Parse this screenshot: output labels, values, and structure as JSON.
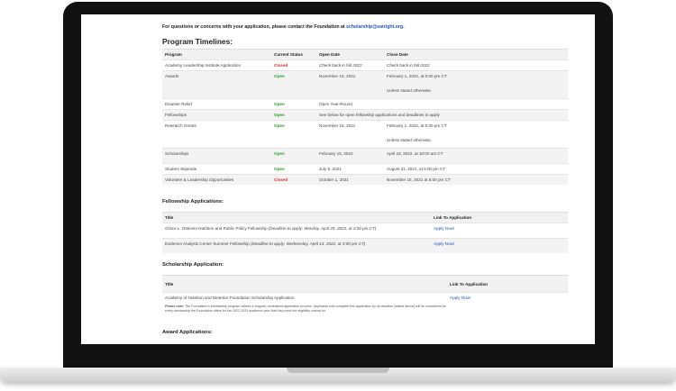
{
  "notice": {
    "text": "For questions or concerns with your application, please contact the Foundation at",
    "email": "scholarship@eatright.org",
    "end": "."
  },
  "timelines": {
    "title": "Program Timelines:",
    "headers": [
      "Program",
      "Current Status",
      "Open Date",
      "Close Date"
    ],
    "rows": [
      {
        "program": "Academy Leadership Institute Application",
        "status": "Closed",
        "open": "Check back in fall 2022",
        "close": "Check back in fall 2022",
        "close2": ""
      },
      {
        "program": "Awards",
        "status": "Open",
        "open": "November 15, 2021",
        "close": "February 1, 2022, at 5:00 pm CT",
        "close2": "Unless stated otherwise."
      },
      {
        "program": "Disaster Relief",
        "status": "Open",
        "open": "Open Year-Round",
        "close": "",
        "close2": ""
      },
      {
        "program": "Fellowships",
        "status": "Open",
        "open": "See below for open fellowship applications and deadlines to apply",
        "close": "",
        "close2": ""
      },
      {
        "program": "Research Grants",
        "status": "Open",
        "open": "November 15, 2021",
        "close": "February 1, 2022, at 5:00 pm CT",
        "close2": "Unless stated otherwise."
      },
      {
        "program": "Scholarships",
        "status": "Open",
        "open": "February 15, 2022",
        "close": "April 19, 2022, at 10:00 am CT",
        "close2": ""
      },
      {
        "program": "Student Stipends",
        "status": "Open",
        "open": "July 9, 2021",
        "close": "August 31, 2021, at 5:00 pm CT",
        "close2": ""
      },
      {
        "program": "Volunteer & Leadership Opportunities",
        "status": "Closed",
        "open": "October 1, 2021",
        "close": "November 15, 2021 at 5:00 pm CT",
        "close2": ""
      }
    ]
  },
  "fellowship": {
    "title": "Fellowship Applications:",
    "headers": [
      "Title",
      "Link To Application"
    ],
    "rows": [
      {
        "name": "Grace L. Ostenso Nutrition and Public Policy Fellowship",
        "deadline": "(Deadline to apply: Monday, April 25, 2022, at 3:00 pm CT)",
        "link": "Apply Now!"
      },
      {
        "name": "Evidence Analysis Center Summer Fellowship",
        "deadline": "(Deadline to apply: Wednesday, April 13, 2022, at 3:00 pm CT)",
        "link": "Apply Now!"
      }
    ]
  },
  "scholarship": {
    "title": "Scholarship Application:",
    "headers": [
      "Title",
      "Link To Application"
    ],
    "rows": [
      {
        "name": "Academy of Nutrition and Dietetics Foundation Scholarship Application",
        "link": "Apply Now!"
      }
    ],
    "note_label": "Please note:",
    "note_text": "The Foundation's scholarship program utilizes a singular, centralized application process. Applicants who complete this application by its deadline (stated above) will be considered for every scholarship the Foundation offers for the 2022-2023 academic year that they meet the eligibility criteria for."
  },
  "award": {
    "title": "Award Applications:"
  },
  "colors": {
    "open": "#2e9d2e",
    "closed": "#d0342c",
    "link": "#2255bb"
  }
}
